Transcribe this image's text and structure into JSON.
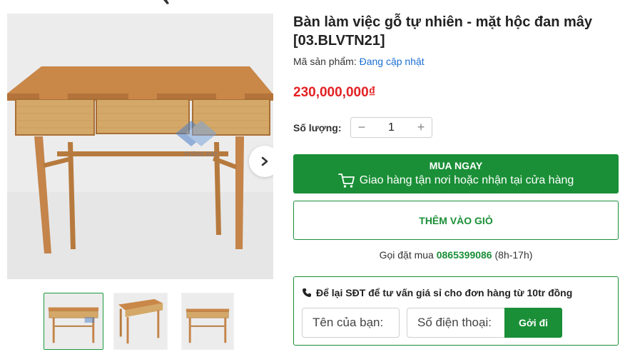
{
  "gallery": {
    "thumbnails": [
      {
        "alt": "thumbnail-1",
        "active": true
      },
      {
        "alt": "thumbnail-2",
        "active": false
      },
      {
        "alt": "thumbnail-3",
        "active": false
      }
    ],
    "next_icon": "chevron-right-icon"
  },
  "product": {
    "title": "Bàn làm việc gỗ tự nhiên - mặt hộc đan mây [03.BLVTN21]",
    "sku_label": "Mã sản phẩm:",
    "sku_value": "Đang cập nhật",
    "price": "230,000,000₫",
    "price_color": "#e32124"
  },
  "quantity": {
    "label": "Số lượng:",
    "value": "1",
    "minus": "−",
    "plus": "+"
  },
  "actions": {
    "buy_now_label": "MUA NGAY",
    "buy_now_sub": "Giao hàng tận nơi hoặc nhận tại cửa hàng",
    "add_to_cart_label": "THÊM VÀO GIỎ",
    "accent_color": "#1a8f37",
    "cart_icon": "cart-icon"
  },
  "hotline": {
    "prefix": "Gọi đặt mua",
    "phone": "0865399086",
    "hours": "(8h-17h)"
  },
  "callback": {
    "title": "Để lại SĐT để tư vấn giá sỉ cho đơn hàng từ 10tr đồng",
    "phone_icon": "phone-icon",
    "name_placeholder": "Tên của bạn:",
    "phone_placeholder": "Số điện thoại:",
    "submit_label": "Gởi đi"
  }
}
